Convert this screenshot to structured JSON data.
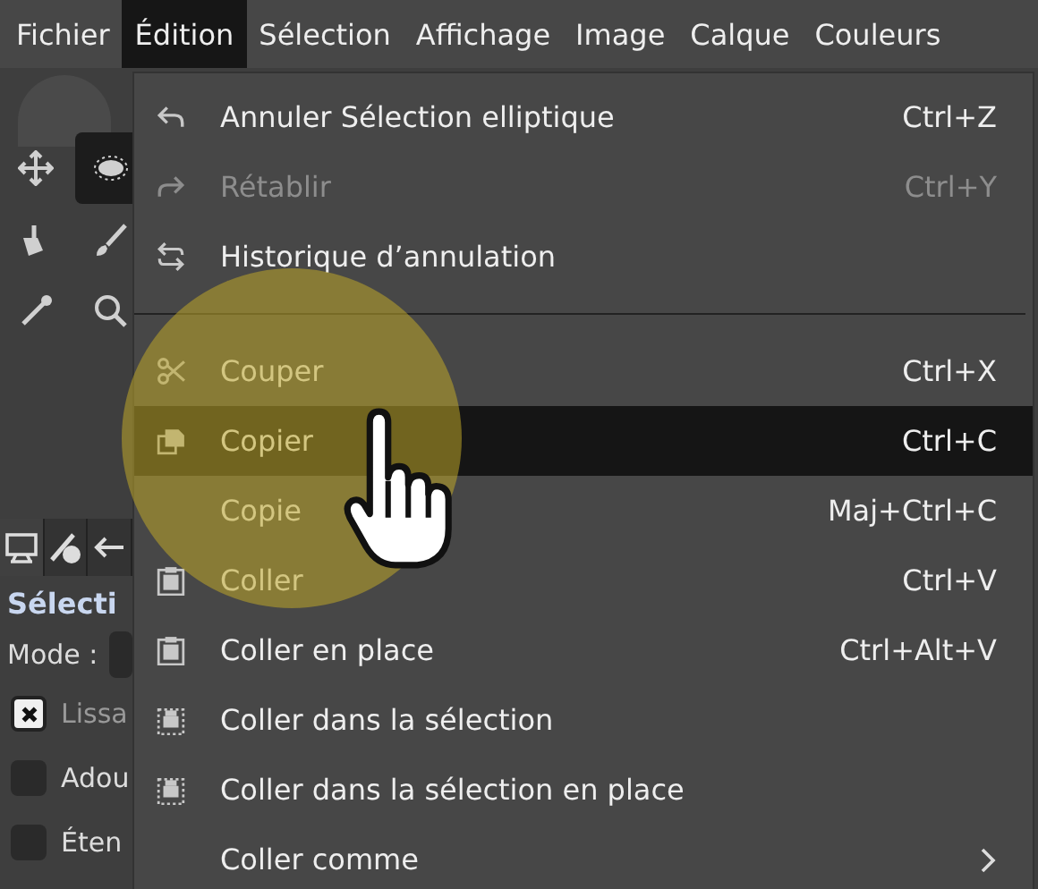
{
  "menubar": [
    {
      "label": "Fichier",
      "selected": false
    },
    {
      "label": "Édition",
      "selected": true
    },
    {
      "label": "Sélection",
      "selected": false
    },
    {
      "label": "Affichage",
      "selected": false
    },
    {
      "label": "Image",
      "selected": false
    },
    {
      "label": "Calque",
      "selected": false
    },
    {
      "label": "Couleurs",
      "selected": false
    }
  ],
  "toolbox": {
    "tools": [
      {
        "kind": "move",
        "selected": false
      },
      {
        "kind": "ellipse",
        "selected": true
      },
      {
        "kind": "bucket",
        "selected": false
      },
      {
        "kind": "brush",
        "selected": false
      },
      {
        "kind": "picker",
        "selected": false
      },
      {
        "kind": "zoom",
        "selected": false
      }
    ]
  },
  "tool_options": {
    "tabs": [
      {
        "kind": "monitor",
        "selected": true
      },
      {
        "kind": "pen",
        "selected": false
      },
      {
        "kind": "undo",
        "selected": false
      }
    ],
    "title": "Sélecti",
    "mode_label": "Mode :",
    "options": [
      {
        "label": "Lissa",
        "checked": true
      },
      {
        "label": "Adou",
        "checked": false
      },
      {
        "label": "Éten",
        "checked": false
      }
    ]
  },
  "edit_menu": {
    "items": [
      {
        "kind": "undo",
        "label": "Annuler Sélection elliptique",
        "shortcut": "Ctrl+Z",
        "disabled": false,
        "selected": false,
        "submenu": false
      },
      {
        "kind": "redo",
        "label": "Rétablir",
        "shortcut": "Ctrl+Y",
        "disabled": true,
        "selected": false,
        "submenu": false
      },
      {
        "kind": "history",
        "label": "Historique d’annulation",
        "disabled": false,
        "selected": false,
        "submenu": false
      },
      {
        "kind": "separator"
      },
      {
        "kind": "scissors",
        "label": "Couper",
        "shortcut": "Ctrl+X",
        "disabled": false,
        "selected": false,
        "submenu": false
      },
      {
        "kind": "copy",
        "label": "Copier",
        "shortcut": "Ctrl+C",
        "disabled": false,
        "selected": true,
        "submenu": false
      },
      {
        "kind": "plain",
        "label": "Copie",
        "shortcut": "Maj+Ctrl+C",
        "disabled": false,
        "selected": false,
        "submenu": false
      },
      {
        "kind": "paste",
        "label": "Coller",
        "shortcut": "Ctrl+V",
        "disabled": false,
        "selected": false,
        "submenu": false
      },
      {
        "kind": "paste",
        "label": "Coller en place",
        "shortcut": "Ctrl+Alt+V",
        "disabled": false,
        "selected": false,
        "submenu": false
      },
      {
        "kind": "paste-into",
        "label": "Coller dans la sélection",
        "disabled": false,
        "selected": false,
        "submenu": false
      },
      {
        "kind": "paste-into",
        "label": "Coller dans la sélection en place",
        "disabled": false,
        "selected": false,
        "submenu": false
      },
      {
        "kind": "plain",
        "label": "Coller comme",
        "disabled": false,
        "selected": false,
        "submenu": true
      }
    ]
  }
}
